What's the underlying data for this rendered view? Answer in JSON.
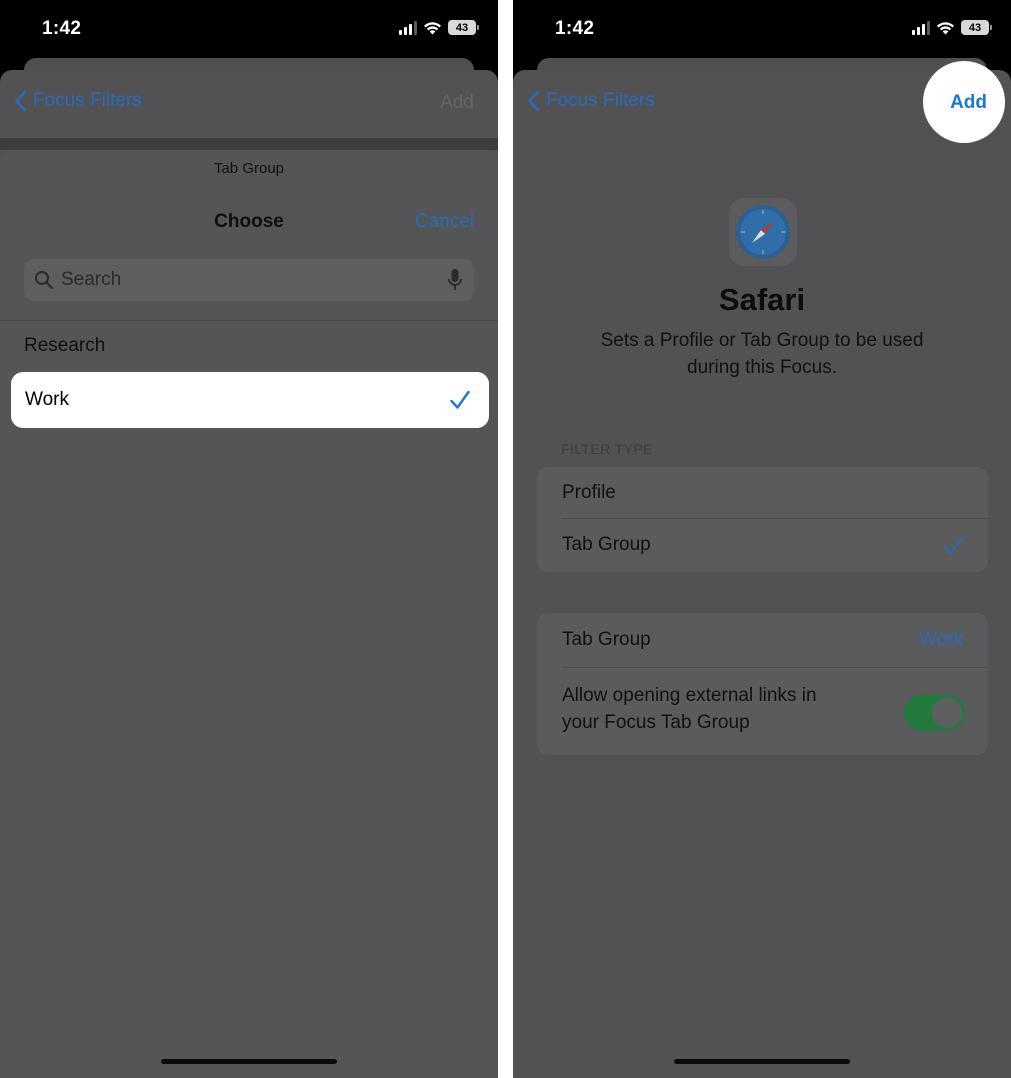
{
  "colors": {
    "accent_blue": "#2b6bb7",
    "bright_blue": "#1877d8",
    "toggle_green": "#227a3e",
    "sheet_gray": "#525254"
  },
  "left_screen": {
    "status": {
      "time": "1:42",
      "battery": "43"
    },
    "nav": {
      "back_icon": "chevron-left-icon",
      "back_label": "Focus Filters",
      "add_label": "Add"
    },
    "picker": {
      "subtitle": "Tab Group",
      "title": "Choose",
      "cancel_label": "Cancel",
      "search_placeholder": "Search",
      "items": [
        {
          "label": "Research",
          "selected": false
        },
        {
          "label": "Work",
          "selected": true
        }
      ]
    }
  },
  "right_screen": {
    "status": {
      "time": "1:42",
      "battery": "43"
    },
    "nav": {
      "back_icon": "chevron-left-icon",
      "back_label": "Focus Filters",
      "add_label": "Add"
    },
    "app": {
      "icon": "safari-compass-icon",
      "name": "Safari",
      "description": "Sets a Profile or Tab Group to be used during this Focus."
    },
    "filter_type": {
      "header": "FILTER TYPE",
      "options": [
        {
          "label": "Profile",
          "selected": false
        },
        {
          "label": "Tab Group",
          "selected": true
        }
      ]
    },
    "settings": {
      "tab_group_label": "Tab Group",
      "tab_group_value": "Work",
      "allow_links_label_line1": "Allow opening external links in",
      "allow_links_label_line2": "your Focus Tab Group",
      "allow_links_on": true
    }
  }
}
